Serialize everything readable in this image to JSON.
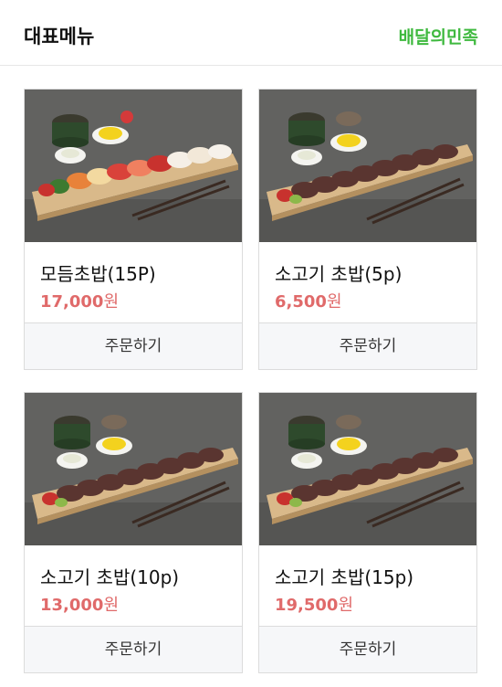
{
  "header": {
    "title": "대표메뉴",
    "brand": "배달의민족"
  },
  "colors": {
    "brand": "#3fb93f",
    "price": "#e06a6a"
  },
  "menu": [
    {
      "name": "모듬초밥(15P)",
      "price": "17,000",
      "currency": "원",
      "order_label": "주문하기",
      "image": "assorted-sushi"
    },
    {
      "name": "소고기 초밥(5p)",
      "price": "6,500",
      "currency": "원",
      "order_label": "주문하기",
      "image": "beef-sushi"
    },
    {
      "name": "소고기 초밥(10p)",
      "price": "13,000",
      "currency": "원",
      "order_label": "주문하기",
      "image": "beef-sushi"
    },
    {
      "name": "소고기 초밥(15p)",
      "price": "19,500",
      "currency": "원",
      "order_label": "주문하기",
      "image": "beef-sushi"
    }
  ]
}
